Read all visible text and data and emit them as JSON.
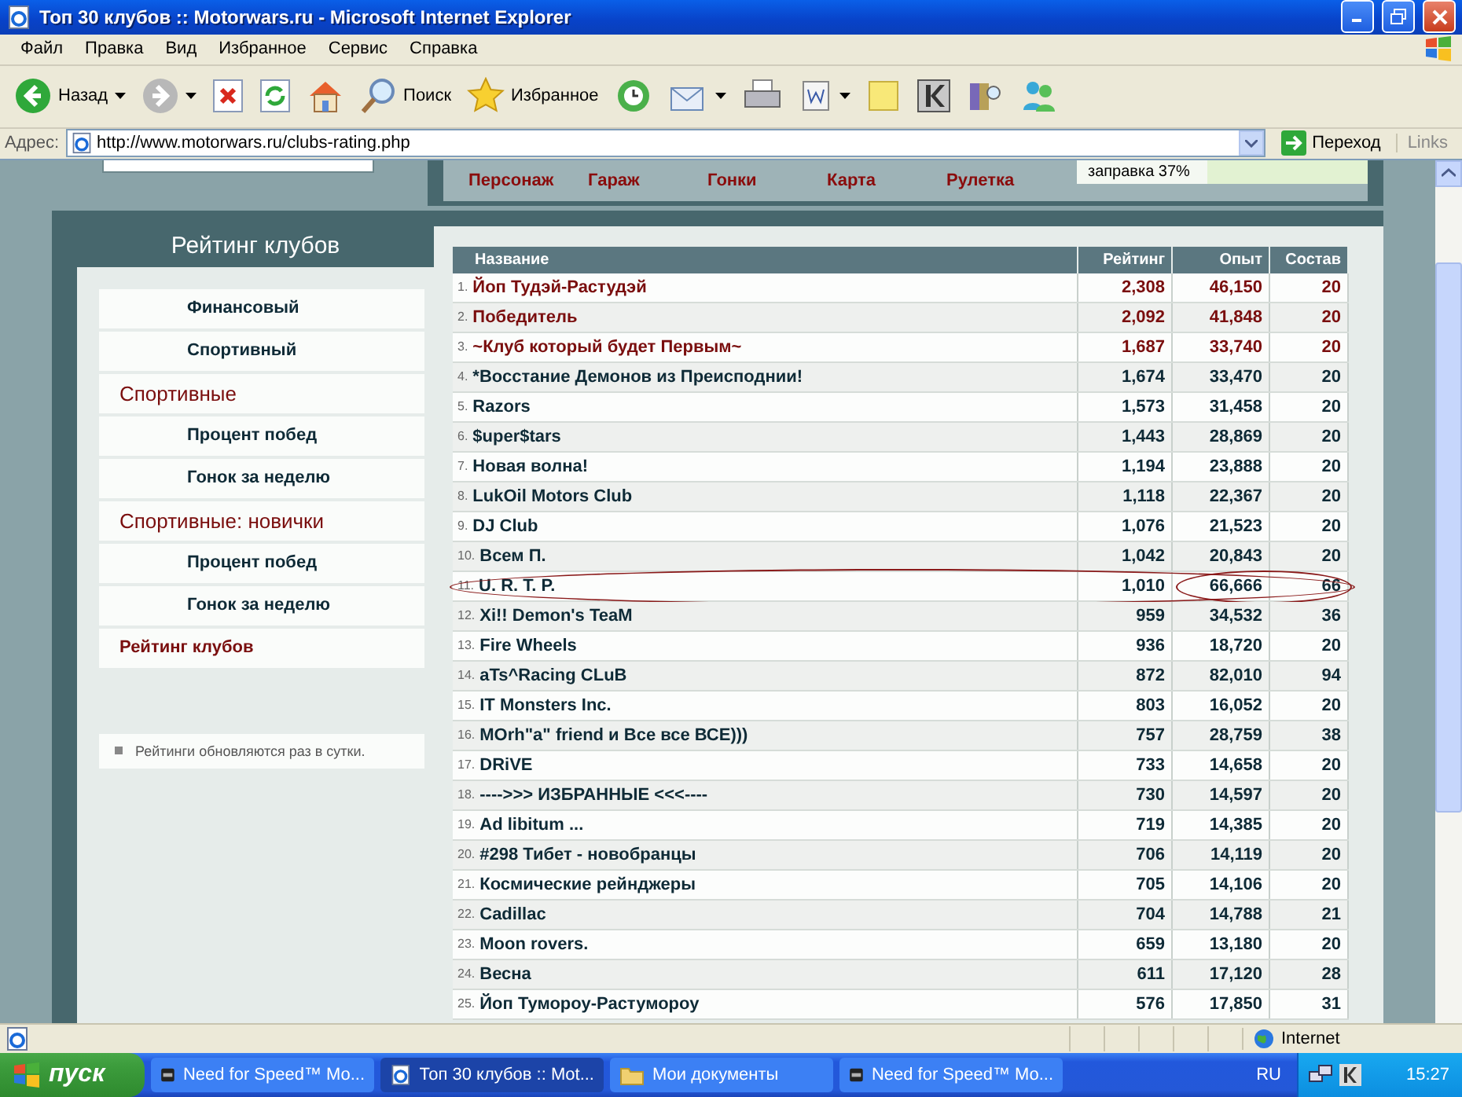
{
  "window": {
    "title": "Топ 30 клубов :: Motorwars.ru - Microsoft Internet Explorer"
  },
  "menu": [
    "Файл",
    "Правка",
    "Вид",
    "Избранное",
    "Сервис",
    "Справка"
  ],
  "toolbar": [
    {
      "kind": "back",
      "label": "Назад",
      "caret": true
    },
    {
      "kind": "forward",
      "caret": true
    },
    {
      "kind": "stop",
      "caret": false
    },
    {
      "kind": "refresh",
      "caret": false
    },
    {
      "kind": "home",
      "caret": false
    },
    {
      "kind": "search",
      "label": "Поиск",
      "caret": false
    },
    {
      "kind": "favorites",
      "label": "Избранное",
      "caret": false
    },
    {
      "kind": "history",
      "caret": false
    },
    {
      "kind": "mail",
      "caret": true
    },
    {
      "kind": "print",
      "caret": false
    },
    {
      "kind": "edit",
      "caret": true
    },
    {
      "kind": "note",
      "caret": false
    },
    {
      "kind": "kapp",
      "caret": false
    },
    {
      "kind": "research",
      "caret": false
    },
    {
      "kind": "messenger",
      "caret": false
    }
  ],
  "address": {
    "label": "Адрес:",
    "url": "http://www.motorwars.ru/clubs-rating.php",
    "go": "Переход",
    "links": "Links"
  },
  "nav": [
    "Персонаж",
    "Гараж",
    "Гонки",
    "Карта",
    "Рулетка"
  ],
  "fuel": {
    "text": "заправка 37%"
  },
  "sidebar": {
    "title": "Рейтинг клубов",
    "items": [
      {
        "label": "Финансовый",
        "kind": "sub"
      },
      {
        "label": "Спортивный",
        "kind": "sub"
      },
      {
        "label": "Спортивные",
        "kind": "group"
      },
      {
        "label": "Процент побед",
        "kind": "sub"
      },
      {
        "label": "Гонок за неделю",
        "kind": "sub"
      },
      {
        "label": "Спортивные: новички",
        "kind": "group"
      },
      {
        "label": "Процент побед",
        "kind": "sub"
      },
      {
        "label": "Гонок за неделю",
        "kind": "sub"
      },
      {
        "label": "Рейтинг клубов",
        "kind": "current"
      }
    ],
    "note": "Рейтинги обновляются раз в сутки."
  },
  "table": {
    "columns": [
      "Название",
      "Рейтинг",
      "Опыт",
      "Состав"
    ],
    "rows": [
      {
        "rank": "1.",
        "name": "Йоп Тудэй-Растудэй",
        "rating": "2,308",
        "exp": "46,150",
        "members": "20",
        "top": true,
        "circled": false
      },
      {
        "rank": "2.",
        "name": "Победитель",
        "rating": "2,092",
        "exp": "41,848",
        "members": "20",
        "top": true,
        "circled": false
      },
      {
        "rank": "3.",
        "name": "~Клуб который будет Первым~",
        "rating": "1,687",
        "exp": "33,740",
        "members": "20",
        "top": true,
        "circled": false
      },
      {
        "rank": "4.",
        "name": "*Восстание Демонов из Преисподнии!",
        "rating": "1,674",
        "exp": "33,470",
        "members": "20",
        "top": false,
        "circled": false
      },
      {
        "rank": "5.",
        "name": "Razors",
        "rating": "1,573",
        "exp": "31,458",
        "members": "20",
        "top": false,
        "circled": false
      },
      {
        "rank": "6.",
        "name": "$uper$tars",
        "rating": "1,443",
        "exp": "28,869",
        "members": "20",
        "top": false,
        "circled": false
      },
      {
        "rank": "7.",
        "name": "Новая волна!",
        "rating": "1,194",
        "exp": "23,888",
        "members": "20",
        "top": false,
        "circled": false
      },
      {
        "rank": "8.",
        "name": "LukOil Motors Club",
        "rating": "1,118",
        "exp": "22,367",
        "members": "20",
        "top": false,
        "circled": false
      },
      {
        "rank": "9.",
        "name": "DJ Club",
        "rating": "1,076",
        "exp": "21,523",
        "members": "20",
        "top": false,
        "circled": false
      },
      {
        "rank": "10.",
        "name": "Всем П.",
        "rating": "1,042",
        "exp": "20,843",
        "members": "20",
        "top": false,
        "circled": false
      },
      {
        "rank": "11.",
        "name": "U. R. T. P.",
        "rating": "1,010",
        "exp": "66,666",
        "members": "66",
        "top": false,
        "circled": true
      },
      {
        "rank": "12.",
        "name": "Xi!! Demon's TeaM",
        "rating": "959",
        "exp": "34,532",
        "members": "36",
        "top": false,
        "circled": false
      },
      {
        "rank": "13.",
        "name": "Fire Wheels",
        "rating": "936",
        "exp": "18,720",
        "members": "20",
        "top": false,
        "circled": false
      },
      {
        "rank": "14.",
        "name": "aTs^Racing CLuB",
        "rating": "872",
        "exp": "82,010",
        "members": "94",
        "top": false,
        "circled": false
      },
      {
        "rank": "15.",
        "name": "IT Monsters Inc.",
        "rating": "803",
        "exp": "16,052",
        "members": "20",
        "top": false,
        "circled": false
      },
      {
        "rank": "16.",
        "name": "MOrh\"a\" friend и Все все ВСЕ)))",
        "rating": "757",
        "exp": "28,759",
        "members": "38",
        "top": false,
        "circled": false
      },
      {
        "rank": "17.",
        "name": "DRiVE",
        "rating": "733",
        "exp": "14,658",
        "members": "20",
        "top": false,
        "circled": false
      },
      {
        "rank": "18.",
        "name": "---->>> ИЗБРАННЫЕ <<<----",
        "rating": "730",
        "exp": "14,597",
        "members": "20",
        "top": false,
        "circled": false
      },
      {
        "rank": "19.",
        "name": "Ad libitum ...",
        "rating": "719",
        "exp": "14,385",
        "members": "20",
        "top": false,
        "circled": false
      },
      {
        "rank": "20.",
        "name": "#298 Тибет - новобранцы",
        "rating": "706",
        "exp": "14,119",
        "members": "20",
        "top": false,
        "circled": false
      },
      {
        "rank": "21.",
        "name": "Космические рейнджеры",
        "rating": "705",
        "exp": "14,106",
        "members": "20",
        "top": false,
        "circled": false
      },
      {
        "rank": "22.",
        "name": "Cadillac",
        "rating": "704",
        "exp": "14,788",
        "members": "21",
        "top": false,
        "circled": false
      },
      {
        "rank": "23.",
        "name": "Moon rovers.",
        "rating": "659",
        "exp": "13,180",
        "members": "20",
        "top": false,
        "circled": false
      },
      {
        "rank": "24.",
        "name": "Весна",
        "rating": "611",
        "exp": "17,120",
        "members": "28",
        "top": false,
        "circled": false
      },
      {
        "rank": "25.",
        "name": "Йоп Тумороу-Растумороу",
        "rating": "576",
        "exp": "17,850",
        "members": "31",
        "top": false,
        "circled": false
      }
    ]
  },
  "status": {
    "zone": "Internet"
  },
  "taskbar": {
    "start": "пуск",
    "tasks": [
      {
        "label": "Need for Speed™ Mo...",
        "kind": "game",
        "selected": false
      },
      {
        "label": "Топ 30 клубов :: Mot...",
        "kind": "browser",
        "selected": true
      },
      {
        "label": "Мои документы",
        "kind": "folder",
        "selected": false
      },
      {
        "label": "Need for Speed™ Mo...",
        "kind": "game",
        "selected": false
      }
    ],
    "lang": "RU",
    "clock": "15:27"
  }
}
